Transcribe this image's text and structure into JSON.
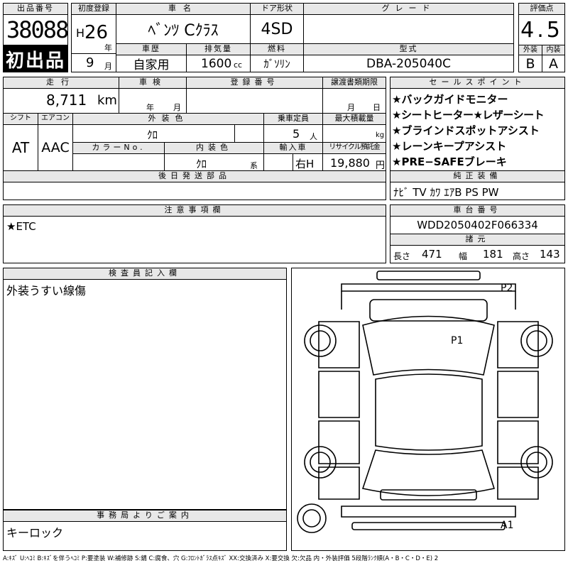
{
  "top": {
    "lot_label": "出品番号",
    "lot_no": "38088",
    "first_listing": "初出品",
    "reg_label": "初度登録",
    "era": "H",
    "reg_year": "26",
    "year_unit": "年",
    "reg_month": "9",
    "month_unit": "月",
    "car_name_label": "車名",
    "car_name": "ﾍﾞﾝﾂ Cｸﾗｽ",
    "door_label": "ドア形状",
    "door": "4SD",
    "grade_label": "グレード",
    "grade": "",
    "score_label": "評価点",
    "score": "4.5",
    "history_label": "車歴",
    "history": "自家用",
    "displacement_label": "排気量",
    "displacement": "1600",
    "cc_unit": "cc",
    "fuel_label": "燃料",
    "fuel": "ｶﾞｿﾘﾝ",
    "model_label": "型式",
    "model": "DBA-205040C",
    "exterior_label": "外装",
    "exterior": "B",
    "interior_label": "内装",
    "interior": "A"
  },
  "mid": {
    "mileage_label": "走行",
    "mileage": "8,711",
    "km_unit": "km",
    "inspection_label": "車検",
    "insp_year_unit": "年",
    "insp_month_unit": "月",
    "regno_label": "登録番号",
    "transfer_label": "譲渡書類期限",
    "transfer_month_unit": "月",
    "transfer_day_unit": "日",
    "shift_label": "シフト",
    "shift": "AT",
    "ac_label": "エアコン",
    "ac": "AAC",
    "color_label": "外装色",
    "color": "ｸﾛ",
    "colorno_label": "カラーNo.",
    "capacity_label": "乗車定員",
    "capacity": "5",
    "person_unit": "人",
    "load_label": "最大積載量",
    "kg_unit": "kg",
    "int_color_label": "内装色",
    "int_color": "ｸﾛ",
    "kei_unit": "系",
    "import_label": "輸入車",
    "handle": "右H",
    "recycle_label": "リサイクル預託金",
    "recycle": "19,880",
    "yen_unit": "円",
    "delivery_label": "後日発送部品"
  },
  "sales": {
    "title": "セールスポイント",
    "points": [
      "★バックガイドモニター",
      "★シートヒーター★レザーシート",
      "★ブラインドスポットアシスト",
      "★レーンキープアシスト",
      "★PRE−SAFEブレーキ"
    ]
  },
  "equipment": {
    "title": "純正装備",
    "text": "ﾅﾋﾞ TV ｶﾜ ｴｱB PS PW"
  },
  "notes": {
    "title": "注意事項欄",
    "text": "★ETC"
  },
  "chassis": {
    "title": "車台番号",
    "number": "WDD2050402F066334",
    "spec_title": "諸元",
    "length_label": "長さ",
    "length": "471",
    "width_label": "幅",
    "width": "181",
    "height_label": "高さ",
    "height": "143"
  },
  "inspector": {
    "title": "検査員記入欄",
    "text": "外装うすい線傷"
  },
  "office": {
    "title": "事務局よりご案内",
    "text": "キーロック"
  },
  "diagram": {
    "p2": "P2",
    "p1": "P1",
    "a1": "A1"
  },
  "legend": "A:ｷｽﾞ U:ﾍｺﾐ B:ｷｽﾞを伴うﾍｺﾐ P:要塗装 W:補修跡 S:錆 C:腐食、穴 G:ﾌﾛﾝﾄｶﾞﾗｽ点ｷｽﾞ XX:交換済み X:要交換 欠:欠品 内・外装評価 5段階ﾗﾝｸ順(A・B・C・D・E) 2"
}
